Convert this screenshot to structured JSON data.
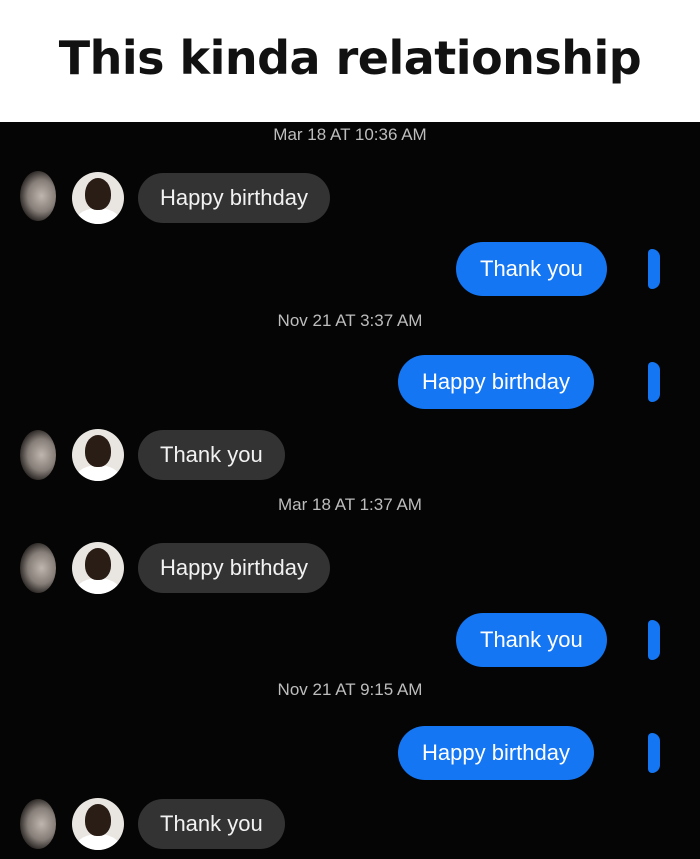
{
  "caption": "This kinda relationship",
  "colors": {
    "chat_bg": "#050505",
    "incoming_bubble": "#333333",
    "outgoing_bubble": "#1476f2",
    "timestamp": "#bdbdbd"
  },
  "messages": {
    "ts1": "Mar 18 AT 10:36 AM",
    "m1": "Happy birthday",
    "m2": "Thank you",
    "ts2": "Nov 21 AT 3:37 AM",
    "m3": "Happy birthday",
    "m4": "Thank you",
    "ts3": "Mar 18 AT 1:37 AM",
    "m5": "Happy birthday",
    "m6": "Thank you",
    "ts4": "Nov 21 AT 9:15 AM",
    "m7": "Happy birthday",
    "m8": "Thank you"
  },
  "icons": {
    "avatar": "user-avatar-icon",
    "seen": "seen-indicator-icon"
  }
}
